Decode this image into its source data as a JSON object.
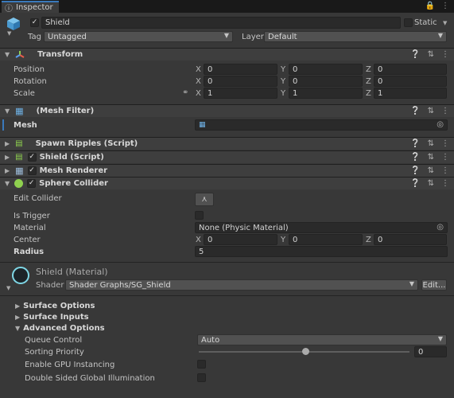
{
  "tab": {
    "label": "Inspector"
  },
  "object": {
    "name": "Shield",
    "static_label": "Static",
    "tag_label": "Tag",
    "tag_value": "Untagged",
    "layer_label": "Layer",
    "layer_value": "Default"
  },
  "transform": {
    "title": "Transform",
    "position_label": "Position",
    "rotation_label": "Rotation",
    "scale_label": "Scale",
    "axis_x": "X",
    "axis_y": "Y",
    "axis_z": "Z",
    "position": [
      "0",
      "0",
      "0"
    ],
    "rotation": [
      "0",
      "0",
      "0"
    ],
    "scale": [
      "1",
      "1",
      "1"
    ]
  },
  "mesh_filter": {
    "title": "(Mesh Filter)",
    "mesh_label": "Mesh",
    "mesh_value": ""
  },
  "spawn_ripples": {
    "title": "Spawn Ripples (Script)"
  },
  "shield_script": {
    "title": "Shield (Script)"
  },
  "mesh_renderer": {
    "title": "Mesh Renderer"
  },
  "sphere_collider": {
    "title": "Sphere Collider",
    "edit_collider_label": "Edit Collider",
    "is_trigger_label": "Is Trigger",
    "material_label": "Material",
    "material_value": "None (Physic Material)",
    "center_label": "Center",
    "center": [
      "0",
      "0",
      "0"
    ],
    "radius_label": "Radius",
    "radius_value": "5"
  },
  "material": {
    "title": "Shield (Material)",
    "shader_label": "Shader",
    "shader_value": "Shader Graphs/SG_Shield",
    "edit_button": "Edit...",
    "surface_options": "Surface Options",
    "surface_inputs": "Surface Inputs",
    "advanced_options": "Advanced Options",
    "queue_control_label": "Queue Control",
    "queue_control_value": "Auto",
    "sorting_priority_label": "Sorting Priority",
    "sorting_priority_value": "0",
    "sorting_priority_fraction": 0.5,
    "gpu_instancing_label": "Enable GPU Instancing",
    "double_sided_gi_label": "Double Sided Global Illumination"
  },
  "colors": {
    "accent": "#3a79bb",
    "material_ring": "#7fd7e6",
    "sphere_icon": "#8fd14f"
  }
}
